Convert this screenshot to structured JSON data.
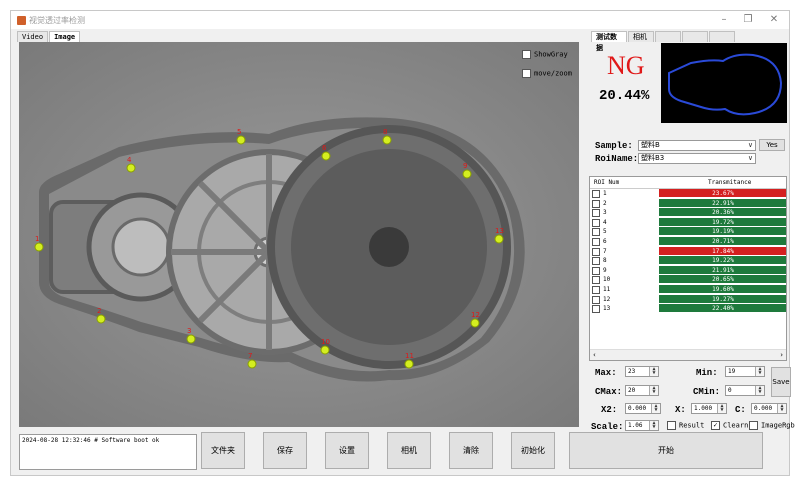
{
  "window": {
    "title": "视觉透过率检测",
    "min_glyph": "–",
    "restore_glyph": "❐",
    "close_glyph": "✕"
  },
  "left_tabs": [
    "Video",
    "Image"
  ],
  "image_panel": {
    "show_gray_label": "ShowGray",
    "move_zoom_label": "move/zoom",
    "points": [
      "1",
      "2",
      "3",
      "4",
      "5",
      "6",
      "7",
      "8",
      "9",
      "10",
      "11",
      "12",
      "13"
    ]
  },
  "right_tabs": [
    "测试数据",
    "相机",
    "",
    "",
    ""
  ],
  "result": {
    "status": "NG",
    "status_color": "#e01818",
    "percent": "20.44%"
  },
  "sample": {
    "label": "Sample:",
    "value": "塑料B",
    "yes_button": "Yes"
  },
  "roi_name": {
    "label": "RoiName:",
    "value": "塑料B3"
  },
  "roi_table": {
    "col_num": "ROI Num",
    "col_trans": "Transmitance",
    "rows": [
      {
        "num": "1",
        "value": "23.67%",
        "state": "fail"
      },
      {
        "num": "2",
        "value": "22.91%",
        "state": "pass"
      },
      {
        "num": "3",
        "value": "20.36%",
        "state": "pass"
      },
      {
        "num": "4",
        "value": "19.72%",
        "state": "pass"
      },
      {
        "num": "5",
        "value": "19.19%",
        "state": "pass"
      },
      {
        "num": "6",
        "value": "20.71%",
        "state": "pass"
      },
      {
        "num": "7",
        "value": "17.84%",
        "state": "fail"
      },
      {
        "num": "8",
        "value": "19.22%",
        "state": "pass"
      },
      {
        "num": "9",
        "value": "21.91%",
        "state": "pass"
      },
      {
        "num": "10",
        "value": "20.65%",
        "state": "pass"
      },
      {
        "num": "11",
        "value": "19.60%",
        "state": "pass"
      },
      {
        "num": "12",
        "value": "19.27%",
        "state": "pass"
      },
      {
        "num": "13",
        "value": "22.40%",
        "state": "pass"
      }
    ],
    "pass_color": "#1e7a3c",
    "fail_color": "#d42020"
  },
  "params": {
    "max_label": "Max:",
    "max_value": "23",
    "min_label": "Min:",
    "min_value": "19",
    "cmax_label": "CMax:",
    "cmax_value": "20",
    "cmin_label": "CMin:",
    "cmin_value": "0",
    "x2_label": "X2:",
    "x2_value": "0.000",
    "x_label": "X:",
    "x_value": "1.000",
    "c_label": "C:",
    "c_value": "0.000",
    "scale_label": "Scale:",
    "scale_value": "1.06",
    "save_button": "Save",
    "result_label": "Result",
    "clearn_label": "Clearn",
    "imagergb_label": "ImageRgb",
    "clearn_checked": "✓"
  },
  "log": {
    "text": "2024-08-28 12:32:46 # Software boot ok"
  },
  "bottom_buttons": {
    "folder": "文件夹",
    "save": "保存",
    "settings": "设置",
    "camera": "相机",
    "clear": "清除",
    "init": "初始化",
    "start": "开始"
  }
}
